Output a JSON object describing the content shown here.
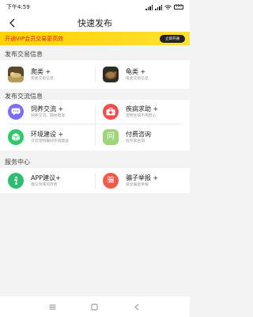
{
  "status_bar": {
    "time": "下午4:59",
    "battery": "100"
  },
  "header": {
    "title": "快速发布"
  },
  "vip_banner": {
    "text": "开通VIP会员交易更高效",
    "button": "立即开通"
  },
  "sections": [
    {
      "title": "发布交易信息",
      "items": [
        {
          "label": "爬类 +",
          "sub": "爬类交易信息",
          "icon": "reptile-photo-icon"
        },
        {
          "label": "龟类 +",
          "sub": "龟类交易信息",
          "icon": "turtle-photo-icon"
        }
      ]
    },
    {
      "title": "发布交流信息",
      "items": [
        {
          "label": "饲养交流 +",
          "sub": "饲养交流，随地暗混",
          "icon": "chat-bubble-icon",
          "color": "#7b6ef6"
        },
        {
          "label": "疾病求助 +",
          "sub": "宠物生病不用担心",
          "icon": "medical-kit-icon",
          "color": "#f04e4e"
        },
        {
          "label": "环境建设 +",
          "sub": "交流宠物最好环境建设",
          "icon": "box-icon",
          "color": "#2ec96b"
        },
        {
          "label": "付费咨询",
          "sub": "找专家咨询",
          "icon": "question-icon",
          "color": "#9fd47a"
        }
      ]
    },
    {
      "title": "服务中心",
      "items": [
        {
          "label": "APP建议+",
          "sub": "建议领域的改善",
          "icon": "info-icon",
          "color": "#2ebd72"
        },
        {
          "label": "骗子举报 +",
          "sub": "袋鼠骗蛋举报",
          "icon": "scam-report-icon",
          "color": "#f05a4a"
        }
      ]
    }
  ],
  "scam_icon_char": "骗",
  "question_icon_char": "问"
}
